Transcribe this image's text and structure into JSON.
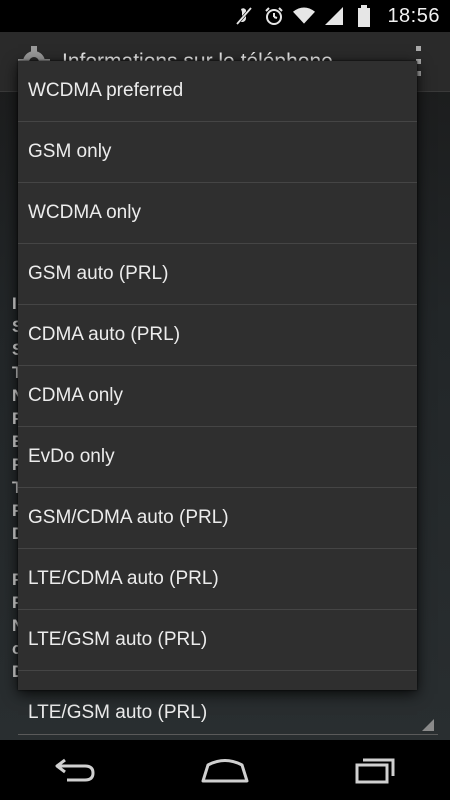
{
  "status_bar": {
    "time": "18:56",
    "icons": [
      "mute-icon",
      "alarm-icon",
      "wifi-icon",
      "signal-icon",
      "battery-icon"
    ]
  },
  "action_bar": {
    "title": "Informations sur le téléphone"
  },
  "background": {
    "letters": [
      "I",
      "S",
      "S",
      "T",
      "N",
      "F",
      "E",
      "F",
      "T",
      "F",
      "D",
      "",
      "F",
      "F",
      "N",
      "c",
      "D"
    ],
    "spinner_value": "LTE/GSM auto (PRL)"
  },
  "popup": {
    "items": [
      "WCDMA preferred",
      "GSM only",
      "WCDMA only",
      "GSM auto (PRL)",
      "CDMA auto (PRL)",
      "CDMA only",
      "EvDo only",
      "GSM/CDMA auto (PRL)",
      "LTE/CDMA auto (PRL)",
      "LTE/GSM auto (PRL)",
      ""
    ]
  },
  "nav_bar": {
    "buttons": [
      "back-icon",
      "home-icon",
      "recents-icon"
    ]
  },
  "colors": {
    "popup_bg": "#2f2f2f",
    "divider": "#454545",
    "status_bar_bg": "#000000"
  }
}
